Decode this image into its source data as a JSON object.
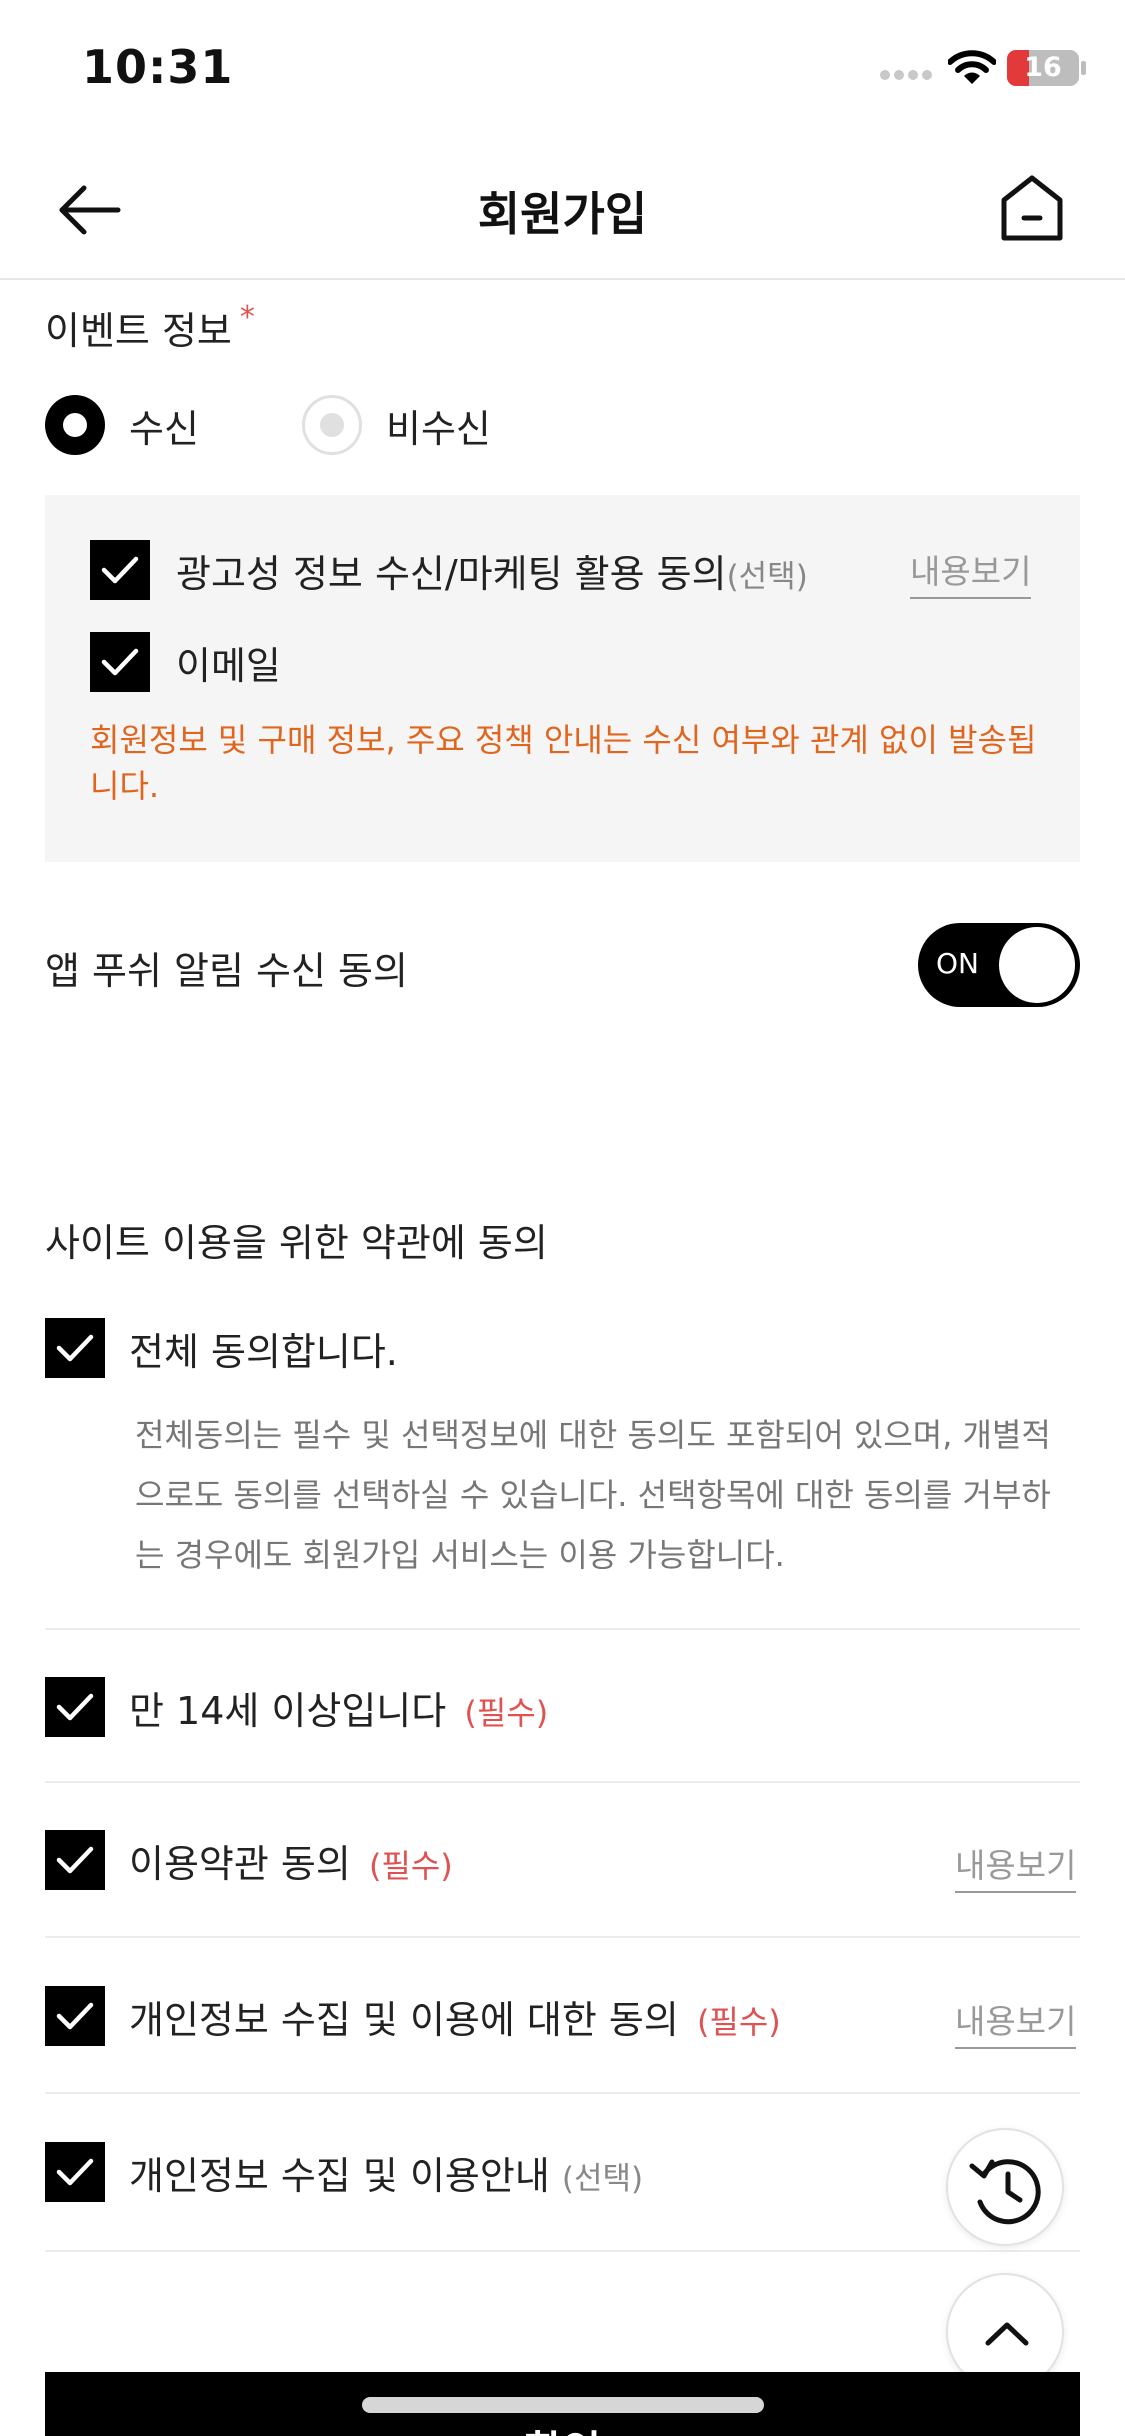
{
  "status_bar": {
    "time": "10:31",
    "battery": "16"
  },
  "header": {
    "title": "회원가입"
  },
  "event_info": {
    "label": "이벤트 정보",
    "required_mark": "*",
    "radio_receive": "수신",
    "radio_reject": "비수신",
    "selected": "수신"
  },
  "consent_box": {
    "marketing_label": "광고성 정보 수신/마케팅 활용 동의",
    "marketing_tag": "(선택)",
    "view_link": "내용보기",
    "email_label": "이메일",
    "notice": "회원정보 및 구매 정보, 주요 정책 안내는 수신 여부와 관계 없이 발송됩니다."
  },
  "push": {
    "label": "앱 푸쉬 알림 수신 동의",
    "toggle_label": "ON",
    "enabled": true
  },
  "terms": {
    "title": "사이트 이용을 위한 약관에 동의",
    "agree_all": "전체 동의합니다.",
    "agree_all_desc": "전체동의는 필수 및 선택정보에 대한 동의도 포함되어 있으며, 개별적으로도 동의를 선택하실 수 있습니다. 선택항목에 대한 동의를 거부하는 경우에도 회원가입 서비스는 이용 가능합니다.",
    "items": [
      {
        "label": "만 14세 이상입니다",
        "tag": "(필수)",
        "view": ""
      },
      {
        "label": "이용약관 동의",
        "tag": "(필수)",
        "view": "내용보기"
      },
      {
        "label": "개인정보 수집 및 이용에 대한 동의",
        "tag": "(필수)",
        "view": "내용보기"
      },
      {
        "label": "개인정보 수집 및 이용안내",
        "tag": "(선택)",
        "view": ""
      }
    ]
  },
  "footer": {
    "confirm_label": "확인"
  },
  "icons": {
    "back": "arrow-left-icon",
    "home": "home-icon",
    "check": "checkmark-icon",
    "history": "history-icon",
    "scroll_top": "chevron-up-icon",
    "wifi": "wifi-icon",
    "battery": "battery-icon",
    "signal": "signal-icon"
  },
  "colors": {
    "accent": "#000000",
    "required": "#e05252",
    "notice": "#e0661f",
    "battery_low": "#e23a3a"
  }
}
